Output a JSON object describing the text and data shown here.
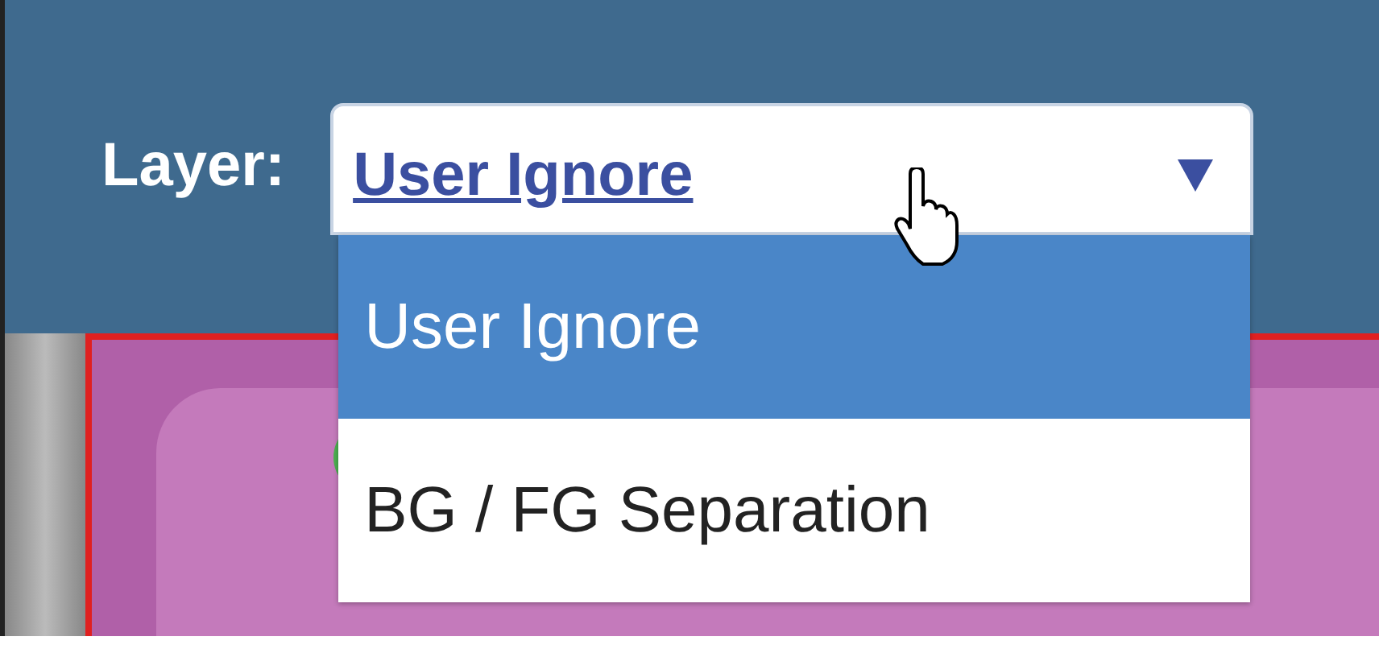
{
  "layer_label": "Layer:",
  "select": {
    "value": "User Ignore"
  },
  "dropdown": {
    "options": [
      {
        "label": "User Ignore",
        "selected": true
      },
      {
        "label": "BG / FG Separation",
        "selected": false
      }
    ]
  }
}
